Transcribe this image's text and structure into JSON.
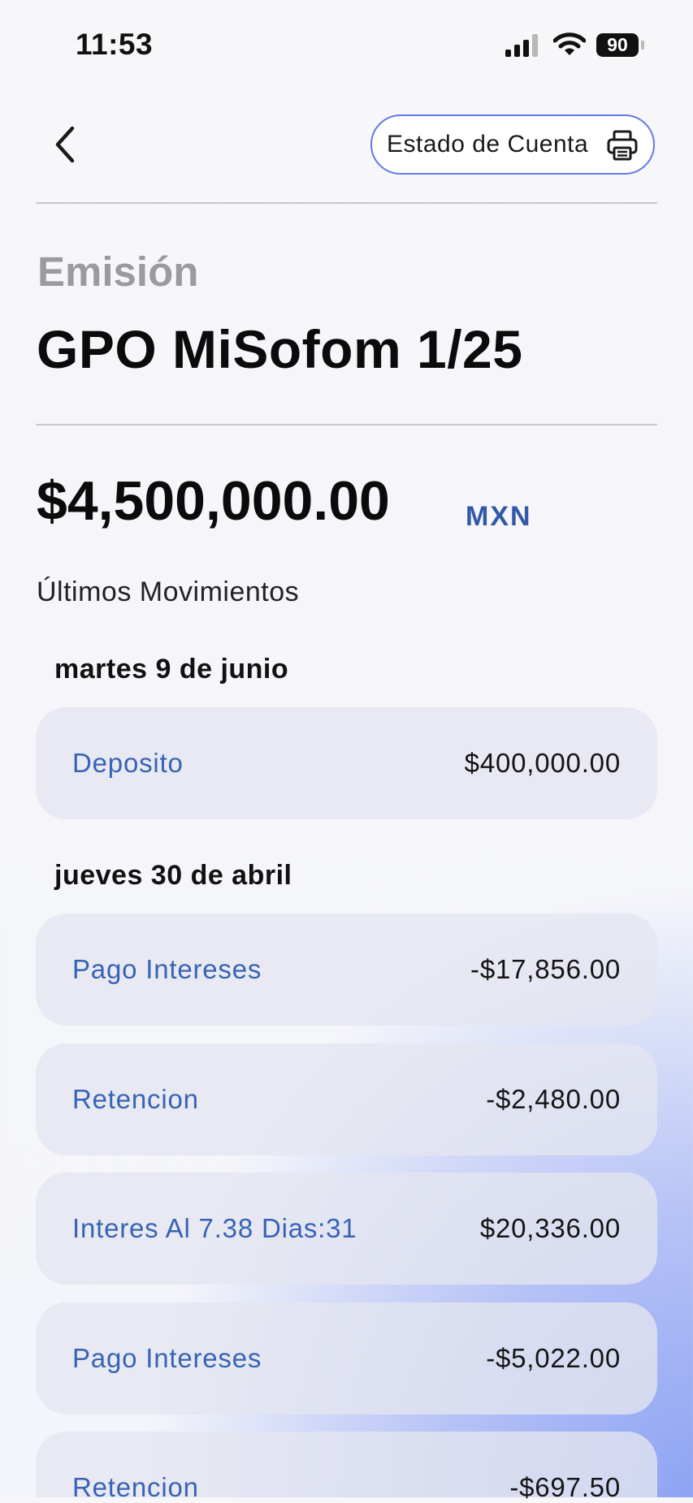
{
  "status_bar": {
    "time": "11:53",
    "battery": "90"
  },
  "header": {
    "statement_button_label": "Estado de Cuenta"
  },
  "emission": {
    "label": "Emisión",
    "name": "GPO MiSofom 1/25"
  },
  "balance": {
    "amount": "$4,500,000.00",
    "currency": "MXN"
  },
  "movements": {
    "heading": "Últimos Movimientos",
    "groups": [
      {
        "date": "martes 9 de junio",
        "items": [
          {
            "description": "Deposito",
            "amount": "$400,000.00"
          }
        ]
      },
      {
        "date": "jueves 30 de abril",
        "items": [
          {
            "description": "Pago Intereses",
            "amount": "-$17,856.00"
          },
          {
            "description": "Retencion",
            "amount": "-$2,480.00"
          },
          {
            "description": "Interes Al 7.38 Dias:31",
            "amount": "$20,336.00"
          },
          {
            "description": "Pago Intereses",
            "amount": "-$5,022.00"
          },
          {
            "description": "Retencion",
            "amount": "-$697.50"
          }
        ]
      }
    ]
  },
  "colors": {
    "accent": "#3863b4",
    "button_border": "#5f79e6",
    "muted": "#9b9b9e"
  },
  "icons": {
    "back": "chevron-left-icon",
    "print": "printer-icon"
  }
}
